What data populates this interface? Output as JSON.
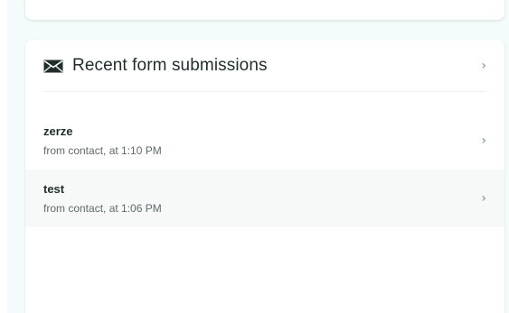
{
  "card": {
    "title": "Recent form submissions",
    "title_icon": "envelope-icon",
    "header_chevron": "›"
  },
  "submissions": [
    {
      "title": "zerze",
      "subtitle": "from contact, at 1:10 PM",
      "chevron": "›"
    },
    {
      "title": "test",
      "subtitle": "from contact, at 1:06 PM",
      "chevron": "›"
    }
  ],
  "colors": {
    "background": "#f3fbfb",
    "card": "#ffffff",
    "row_alt": "#f7f9f9",
    "text": "#1f2d2b",
    "muted": "#5f6b69"
  }
}
